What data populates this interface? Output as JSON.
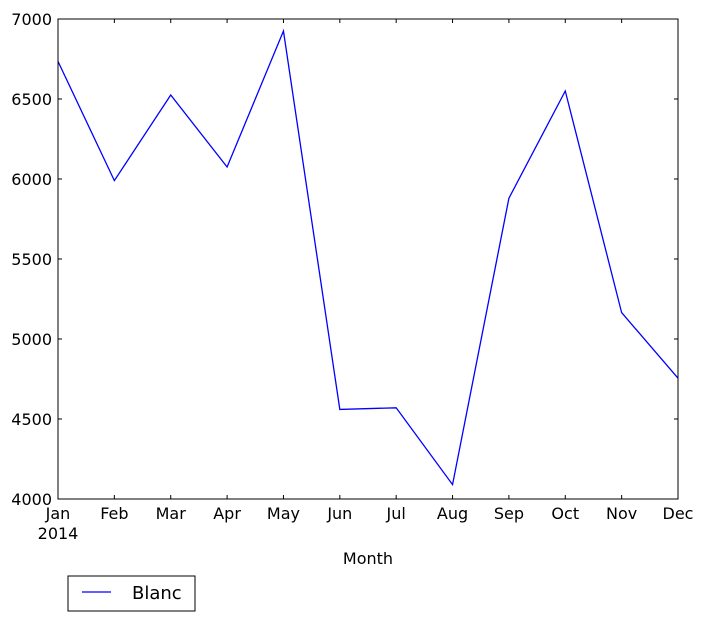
{
  "chart_data": {
    "type": "line",
    "title": "",
    "xlabel": "Month",
    "ylabel": "",
    "categories": [
      "Jan",
      "Feb",
      "Mar",
      "Apr",
      "May",
      "Jun",
      "Jul",
      "Aug",
      "Sep",
      "Oct",
      "Nov",
      "Dec"
    ],
    "x_tick_labels": [
      "Jan",
      "Feb",
      "Mar",
      "Apr",
      "May",
      "Jun",
      "Jul",
      "Aug",
      "Sep",
      "Oct",
      "Nov",
      "Dec"
    ],
    "x_year_label": "2014",
    "ylim": [
      4000,
      7000
    ],
    "y_ticks": [
      4000,
      4500,
      5000,
      5500,
      6000,
      6500,
      7000
    ],
    "y_tick_labels": [
      "4000",
      "4500",
      "5000",
      "5500",
      "6000",
      "6500",
      "7000"
    ],
    "grid": false,
    "legend": {
      "placement": "bottom-left-outside",
      "entries": [
        "Blanc"
      ]
    },
    "series": [
      {
        "name": "Blanc",
        "color": "#0000ff",
        "values": [
          6735,
          5990,
          6525,
          6075,
          6925,
          4560,
          4570,
          4090,
          5880,
          6550,
          5165,
          4755
        ]
      }
    ]
  }
}
